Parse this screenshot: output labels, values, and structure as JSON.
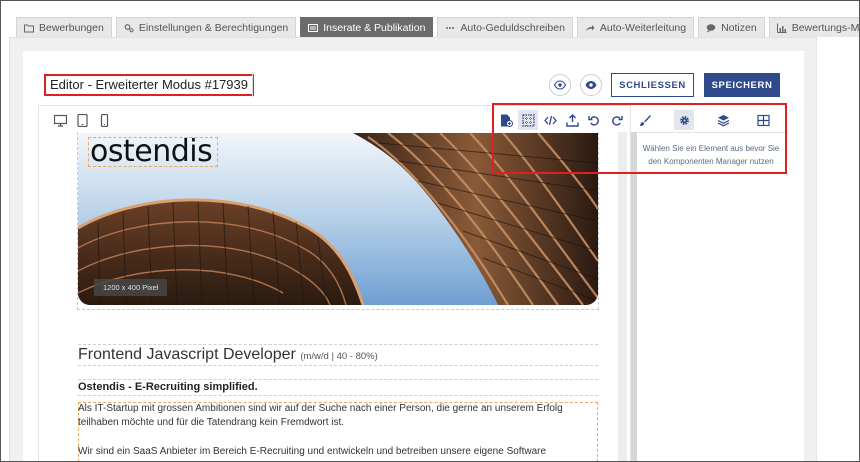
{
  "tabs": [
    {
      "label": "Bewerbungen",
      "icon": "folder-icon",
      "active": false
    },
    {
      "label": "Einstellungen & Berechtigungen",
      "icon": "gears-icon",
      "active": false
    },
    {
      "label": "Inserate & Publikation",
      "icon": "newspaper-icon",
      "active": true
    },
    {
      "label": "Auto-Geduldschreiben",
      "icon": "dots-icon",
      "active": false
    },
    {
      "label": "Auto-Weiterleitung",
      "icon": "share-icon",
      "active": false
    },
    {
      "label": "Notizen",
      "icon": "comment-icon",
      "active": false
    },
    {
      "label": "Bewertungs-Matrix",
      "icon": "bar-chart-icon",
      "active": false
    }
  ],
  "editor": {
    "title": "Editor - Erweiterter Modus #17939",
    "close_label": "SCHLIESSEN",
    "save_label": "SPEICHERN"
  },
  "side_panel": {
    "message": "Wählen Sie ein Element aus bevor Sie den Komponenten Manager nutzen"
  },
  "content": {
    "logo": "ostendis",
    "image_size": "1200 x 400 Pixel",
    "job_title": "Frontend Javascript Developer",
    "job_meta": "(m/w/d | 40 - 80%)",
    "company": "Ostendis - E-Recruiting simplified.",
    "paragraph1": "Als IT-Startup mit grossen Ambitionen sind wir auf der Suche nach einer Person, die gerne an unserem Erfolg teilhaben möchte und für die Tatendrang kein Fremdwort ist.",
    "paragraph2": "Wir sind ein SaaS Anbieter im Bereich E-Recruiting und entwickeln und betreiben unsere eigene Software"
  },
  "colors": {
    "accent": "#2e4a8c",
    "highlight": "#e02020",
    "active_tab": "#6b6b6b"
  }
}
